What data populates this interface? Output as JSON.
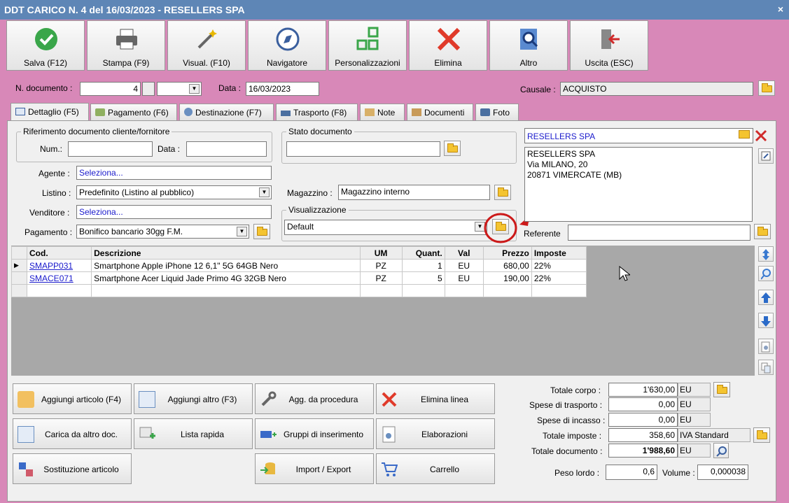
{
  "window": {
    "title": "DDT CARICO N. 4 del 16/03/2023 - RESELLERS SPA",
    "close": "×"
  },
  "toolbar": [
    "Salva (F12)",
    "Stampa (F9)",
    "Visual. (F10)",
    "Navigatore",
    "Personalizzazioni",
    "Elimina",
    "Altro",
    "Uscita (ESC)"
  ],
  "header": {
    "n_documento_label": "N. documento :",
    "n_documento": "4",
    "data_label": "Data :",
    "data": "16/03/2023",
    "causale_label": "Causale :",
    "causale": "ACQUISTO"
  },
  "tabs": [
    "Dettaglio (F5)",
    "Pagamento (F6)",
    "Destinazione (F7)",
    "Trasporto (F8)",
    "Note",
    "Documenti",
    "Foto"
  ],
  "rif": {
    "title": "Riferimento documento cliente/fornitore",
    "num_label": "Num.:",
    "data_label": "Data :"
  },
  "stato": {
    "title": "Stato documento"
  },
  "fields": {
    "agente_label": "Agente :",
    "agente": "Seleziona...",
    "listino_label": "Listino :",
    "listino": "Predefinito (Listino al pubblico)",
    "venditore_label": "Venditore :",
    "venditore": "Seleziona...",
    "pagamento_label": "Pagamento :",
    "pagamento": "Bonifico bancario 30gg F.M.",
    "magazzino_label": "Magazzino :",
    "magazzino": "Magazzino interno",
    "visualizzazione_title": "Visualizzazione",
    "visualizzazione": "Default",
    "referente_label": "Referente"
  },
  "cliente": {
    "name": "RESELLERS SPA",
    "address_lines": [
      "RESELLERS SPA",
      "Via MILANO, 20",
      "20871 VIMERCATE (MB)"
    ]
  },
  "grid": {
    "headers": [
      "Cod.",
      "Descrizione",
      "UM",
      "Quant.",
      "Val",
      "Prezzo",
      "Imposte"
    ],
    "rows": [
      [
        "SMAPP031",
        "Smartphone Apple iPhone 12 6,1\" 5G 64GB Nero",
        "PZ",
        "1",
        "EU",
        "680,00",
        "22%"
      ],
      [
        "SMACE071",
        "Smartphone Acer Liquid Jade Primo 4G 32GB Nero",
        "PZ",
        "5",
        "EU",
        "190,00",
        "22%"
      ]
    ]
  },
  "actions": [
    "Aggiungi articolo (F4)",
    "Aggiungi altro (F3)",
    "Agg. da procedura",
    "Elimina linea",
    "Carica da altro doc.",
    "Lista rapida",
    "Gruppi di inserimento",
    "Elaborazioni",
    "Sostituzione articolo",
    "Import / Export",
    "Carrello"
  ],
  "totals": {
    "corpo_label": "Totale corpo :",
    "corpo": "1'630,00",
    "corpo_unit": "EU",
    "trasporto_label": "Spese di trasporto :",
    "trasporto": "0,00",
    "trasporto_unit": "EU",
    "incasso_label": "Spese di incasso :",
    "incasso": "0,00",
    "incasso_unit": "EU",
    "imposte_label": "Totale imposte :",
    "imposte": "358,60",
    "imposte_unit": "IVA Standard",
    "documento_label": "Totale documento :",
    "documento": "1'988,60",
    "documento_unit": "EU",
    "peso_label": "Peso lordo :",
    "peso": "0,6",
    "volume_label": "Volume :",
    "volume": "0,000038"
  },
  "colors": {
    "frame": "#d888b8",
    "titlebar": "#5e86b6",
    "annotation": "#cc1a1a"
  }
}
